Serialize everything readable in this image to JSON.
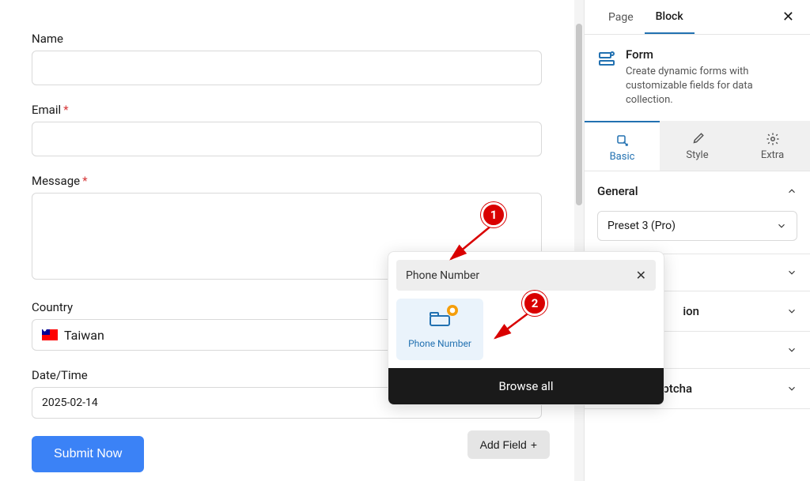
{
  "form": {
    "name_label": "Name",
    "email_label": "Email",
    "message_label": "Message",
    "country_label": "Country",
    "country_value": "Taiwan",
    "datetime_label": "Date/Time",
    "datetime_value": "2025-02-14",
    "submit_label": "Submit Now",
    "add_field_label": "Add Field"
  },
  "sidebar": {
    "tabs": {
      "page": "Page",
      "block": "Block"
    },
    "block_title": "Form",
    "block_desc": "Create dynamic forms with customizable fields for data collection.",
    "sub_tabs": {
      "basic": "Basic",
      "style": "Style",
      "extra": "Extra"
    },
    "sections": {
      "general": "General",
      "preset_value": "Preset 3 (Pro)",
      "partial_ion": "ion",
      "recaptcha": "Google reCaptcha"
    }
  },
  "popup": {
    "search_value": "Phone Number",
    "item_label": "Phone Number",
    "browse_all": "Browse all"
  },
  "annotations": {
    "one": "1",
    "two": "2"
  }
}
